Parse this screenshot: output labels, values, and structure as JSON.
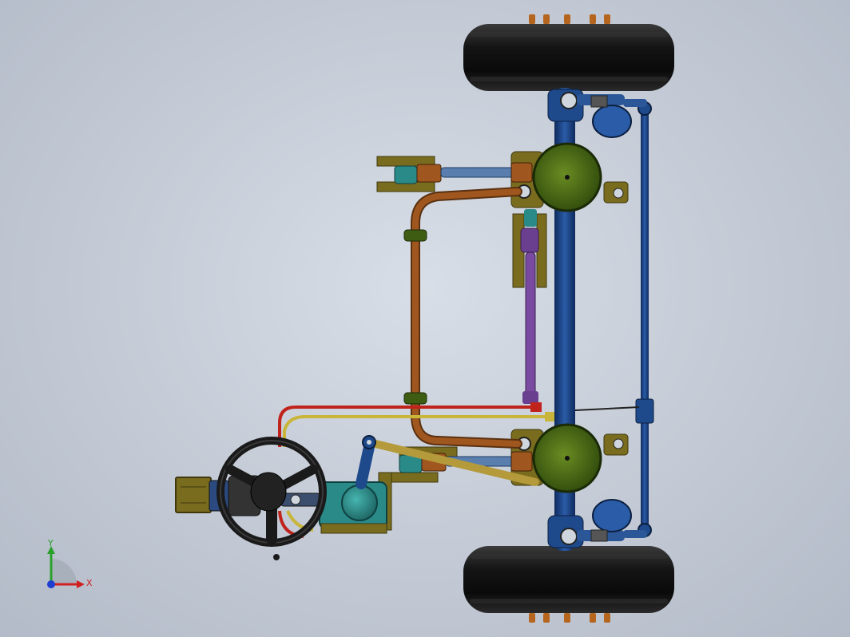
{
  "viewport": {
    "background_color": "#c9d0da"
  },
  "assembly": {
    "tire_color": "#101010",
    "axle_color": "#1e4a8c",
    "hub_color": "#3f5d12",
    "bracket_color": "#7a6c1e",
    "radius_rod_color": "#8a4a17",
    "track_rod_color": "#6b3f8f",
    "brake_line_red": "#c0231b",
    "brake_line_yellow": "#c8b53a",
    "steering_box_color": "#2a8a88",
    "steering_wheel_color": "#1a1a1a"
  },
  "triad": {
    "y_label": "Y",
    "x_label": "X",
    "y_color": "#2aa02a",
    "x_color": "#d02020",
    "z_color": "#1f3fd0"
  }
}
